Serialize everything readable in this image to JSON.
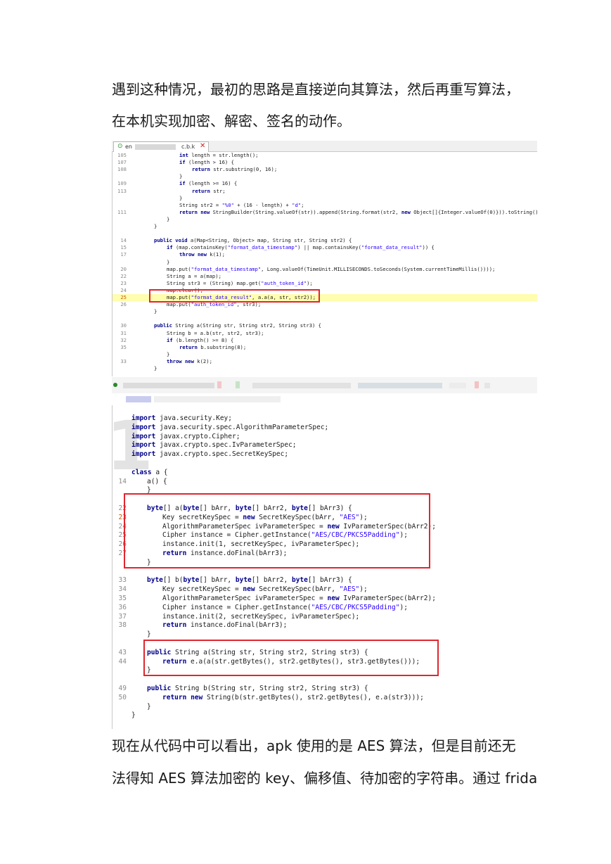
{
  "paragraphs": {
    "p1_line1": "遇到这种情况，最初的思路是直接逆向其算法，然后再重写算法，",
    "p1_line2": "在本机实现加密、解密、签名的动作。",
    "p2_line1": "现在从代码中可以看出，apk 使用的是 AES 算法，但是目前还无",
    "p2_line2": "法得知 AES 算法加密的 key、偏移值、待加密的字符串。通过 frida"
  },
  "screenshot1": {
    "tab": {
      "prefix": "en",
      "suffix": "c.b.k",
      "close": "✕"
    },
    "lines": [
      {
        "n": "105",
        "indent": 3,
        "html": "<span class='k'>int</span> length = str.length();"
      },
      {
        "n": "107",
        "indent": 3,
        "html": "<span class='k'>if</span> (length &gt; 16) {"
      },
      {
        "n": "108",
        "indent": 4,
        "html": "<span class='k'>return</span> str.substring(0, 16);"
      },
      {
        "n": "",
        "indent": 3,
        "html": "}"
      },
      {
        "n": "109",
        "indent": 3,
        "html": "<span class='k'>if</span> (length &gt;= 16) {"
      },
      {
        "n": "113",
        "indent": 4,
        "html": "<span class='k'>return</span> str;"
      },
      {
        "n": "",
        "indent": 3,
        "html": "}"
      },
      {
        "n": "",
        "indent": 3,
        "html": "String str2 = <span class='s'>\"%0\"</span> + (16 - length) + <span class='s'>\"d\"</span>;"
      },
      {
        "n": "111",
        "indent": 3,
        "html": "<span class='k'>return</span> <span class='k'>new</span> StringBuilder(String.valueOf(str)).append(String.format(str2, <span class='k'>new</span> Object[]{Integer.valueOf(0)})).toString();"
      },
      {
        "n": "",
        "indent": 2,
        "html": "}"
      },
      {
        "n": "",
        "indent": 1,
        "html": "}"
      },
      {
        "n": "",
        "indent": 0,
        "html": ""
      },
      {
        "n": "14",
        "indent": 1,
        "html": "<span class='k'>public</span> <span class='k'>void</span> a(Map&lt;String, Object&gt; map, String str, String str2) {"
      },
      {
        "n": "15",
        "indent": 2,
        "html": "<span class='k'>if</span> (map.containsKey(<span class='s'>\"format_data_timestamp\"</span>) || map.containsKey(<span class='s'>\"format_data_result\"</span>)) {"
      },
      {
        "n": "17",
        "indent": 3,
        "html": "<span class='k'>throw</span> <span class='k'>new</span> k(1);"
      },
      {
        "n": "",
        "indent": 2,
        "html": "}"
      },
      {
        "n": "20",
        "indent": 2,
        "html": "map.put(<span class='s'>\"format_data_timestamp\"</span>, Long.valueOf(TimeUnit.MILLISECONDS.toSeconds(System.currentTimeMillis())));"
      },
      {
        "n": "22",
        "indent": 2,
        "html": "String a = a(map);"
      },
      {
        "n": "23",
        "indent": 2,
        "html": "String str3 = (String) map.get(<span class='s'>\"auth_token_id\"</span>);"
      },
      {
        "n": "24",
        "indent": 2,
        "html": "map.clear();"
      },
      {
        "n": "25",
        "indent": 2,
        "html": "map.put(<span class='s'>\"format_data_result\"</span>, a.a(a, str, str2));",
        "hl": true
      },
      {
        "n": "26",
        "indent": 2,
        "html": "map.put(<span class='s'>\"auth_token_id\"</span>, str3);"
      },
      {
        "n": "",
        "indent": 1,
        "html": "}"
      },
      {
        "n": "",
        "indent": 0,
        "html": ""
      },
      {
        "n": "30",
        "indent": 1,
        "html": "<span class='k'>public</span> String a(String str, String str2, String str3) {"
      },
      {
        "n": "31",
        "indent": 2,
        "html": "String b = a.b(str, str2, str3);"
      },
      {
        "n": "32",
        "indent": 2,
        "html": "<span class='k'>if</span> (b.length() &gt;= 8) {"
      },
      {
        "n": "35",
        "indent": 3,
        "html": "<span class='k'>return</span> b.substring(8);"
      },
      {
        "n": "",
        "indent": 2,
        "html": "}"
      },
      {
        "n": "33",
        "indent": 2,
        "html": "<span class='k'>throw</span> <span class='k'>new</span> k(2);"
      },
      {
        "n": "",
        "indent": 1,
        "html": "}"
      }
    ]
  },
  "screenshot2": {
    "lines": [
      {
        "n": "",
        "indent": 0,
        "html": "<span class='k'>import</span> java.security.Key;"
      },
      {
        "n": "",
        "indent": 0,
        "html": "<span class='k'>import</span> java.security.spec.AlgorithmParameterSpec;"
      },
      {
        "n": "",
        "indent": 0,
        "html": "<span class='k'>import</span> javax.crypto.Cipher;"
      },
      {
        "n": "",
        "indent": 0,
        "html": "<span class='k'>import</span> javax.crypto.spec.IvParameterSpec;"
      },
      {
        "n": "",
        "indent": 0,
        "html": "<span class='k'>import</span> javax.crypto.spec.SecretKeySpec;"
      },
      {
        "n": "",
        "indent": 0,
        "html": ""
      },
      {
        "n": "",
        "indent": 0,
        "html": "<span class='k'>class</span> a {"
      },
      {
        "n": "14",
        "indent": 1,
        "html": "a() {"
      },
      {
        "n": "",
        "indent": 1,
        "html": "}"
      },
      {
        "n": "",
        "indent": 0,
        "html": ""
      },
      {
        "n": "22",
        "indent": 1,
        "html": "<span class='k'>byte</span>[] a(<span class='k'>byte</span>[] bArr, <span class='k'>byte</span>[] bArr2, <span class='k'>byte</span>[] bArr3) {"
      },
      {
        "n": "23",
        "indent": 2,
        "html": "Key secretKeySpec = <span class='k'>new</span> SecretKeySpec(bArr, <span class='s'>\"AES\"</span>);",
        "hl": true
      },
      {
        "n": "24",
        "indent": 2,
        "html": "AlgorithmParameterSpec ivParameterSpec = <span class='k'>new</span> IvParameterSpec(bArr2);"
      },
      {
        "n": "25",
        "indent": 2,
        "html": "Cipher instance = Cipher.getInstance(<span class='s'>\"AES/CBC/PKCS5Padding\"</span>);"
      },
      {
        "n": "26",
        "indent": 2,
        "html": "instance.init(1, secretKeySpec, ivParameterSpec);"
      },
      {
        "n": "27",
        "indent": 2,
        "html": "<span class='k'>return</span> instance.doFinal(bArr3);"
      },
      {
        "n": "",
        "indent": 1,
        "html": "}"
      },
      {
        "n": "",
        "indent": 0,
        "html": ""
      },
      {
        "n": "33",
        "indent": 1,
        "html": "<span class='k'>byte</span>[] b(<span class='k'>byte</span>[] bArr, <span class='k'>byte</span>[] bArr2, <span class='k'>byte</span>[] bArr3) {"
      },
      {
        "n": "34",
        "indent": 2,
        "html": "Key secretKeySpec = <span class='k'>new</span> SecretKeySpec(bArr, <span class='s'>\"AES\"</span>);"
      },
      {
        "n": "35",
        "indent": 2,
        "html": "AlgorithmParameterSpec ivParameterSpec = <span class='k'>new</span> IvParameterSpec(bArr2);"
      },
      {
        "n": "36",
        "indent": 2,
        "html": "Cipher instance = Cipher.getInstance(<span class='s'>\"AES/CBC/PKCS5Padding\"</span>);"
      },
      {
        "n": "37",
        "indent": 2,
        "html": "instance.init(2, secretKeySpec, ivParameterSpec);"
      },
      {
        "n": "38",
        "indent": 2,
        "html": "<span class='k'>return</span> instance.doFinal(bArr3);"
      },
      {
        "n": "",
        "indent": 1,
        "html": "}"
      },
      {
        "n": "",
        "indent": 0,
        "html": ""
      },
      {
        "n": "43",
        "indent": 1,
        "html": "<span class='k'>public</span> String a(String str, String str2, String str3) {"
      },
      {
        "n": "44",
        "indent": 2,
        "html": "<span class='k'>return</span> e.a(a(str.getBytes(), str2.getBytes(), str3.getBytes()));"
      },
      {
        "n": "",
        "indent": 1,
        "html": "}"
      },
      {
        "n": "",
        "indent": 0,
        "html": ""
      },
      {
        "n": "49",
        "indent": 1,
        "html": "<span class='k'>public</span> String b(String str, String str2, String str3) {"
      },
      {
        "n": "50",
        "indent": 2,
        "html": "<span class='k'>return</span> <span class='k'>new</span> String(b(str.getBytes(), str2.getBytes(), e.a(str3)));"
      },
      {
        "n": "",
        "indent": 1,
        "html": "}"
      },
      {
        "n": "",
        "indent": 0,
        "html": "}"
      }
    ]
  },
  "colors": {
    "keyword": "#00008b",
    "string": "#2a00ff",
    "highlight_box": "#e0262e",
    "current_line": "#fffdae"
  },
  "icons": [
    "class-file-icon",
    "close-tab-icon"
  ]
}
